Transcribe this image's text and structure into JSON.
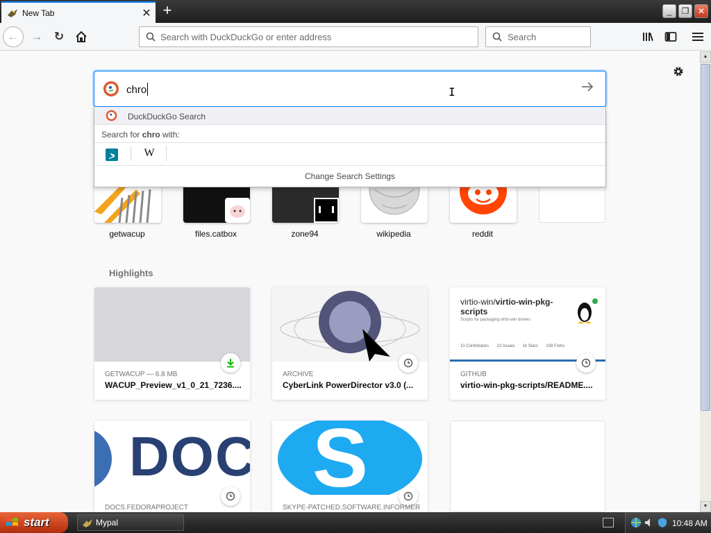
{
  "window": {
    "tab_title": "New Tab",
    "tab_close": "✕",
    "new_tab": "+",
    "minimize": "_",
    "restore": "❐",
    "close": "✕"
  },
  "navbar": {
    "back": "←",
    "forward": "→",
    "reload": "↻",
    "home": "⌂",
    "url_placeholder": "Search with DuckDuckGo or enter address",
    "search_placeholder": "Search"
  },
  "search": {
    "value": "chro",
    "engine_label": "DuckDuckGo Search",
    "search_for_prefix": "Search for ",
    "search_for_term": "chro",
    "search_for_suffix": " with:",
    "change_settings": "Change Search Settings",
    "engines": [
      "bing-icon",
      "wikipedia-icon"
    ]
  },
  "top_sites": [
    {
      "label": "getwacup"
    },
    {
      "label": "files.catbox"
    },
    {
      "label": "zone94"
    },
    {
      "label": "wikipedia"
    },
    {
      "label": "reddit"
    },
    {
      "label": ""
    }
  ],
  "highlights": {
    "title": "Highlights",
    "cards": [
      {
        "context": "GETWACUP — 6.8 MB",
        "title": "WACUP_Preview_v1_0_21_7236....",
        "badge": "download-icon"
      },
      {
        "context": "ARCHIVE",
        "title": "CyberLink PowerDirector v3.0 (...",
        "badge": "clock-icon"
      },
      {
        "context": "GITHUB",
        "title": "virtio-win-pkg-scripts/README....",
        "badge": "clock-icon",
        "preview_repo_owner": "virtio-win/",
        "preview_repo_name": "virtio-win-pkg-scripts",
        "preview_desc": "Scripts for packaging virtio-win drivers",
        "preview_stats": [
          {
            "value": "10",
            "label": "Contributors"
          },
          {
            "value": "22",
            "label": "Issues"
          },
          {
            "value": "1k",
            "label": "Stars"
          },
          {
            "value": "108",
            "label": "Forks"
          }
        ]
      },
      {
        "context": "DOCS.FEDORAPROJECT",
        "title": "",
        "badge": "clock-icon",
        "preview_text": "DOC"
      },
      {
        "context": "SKYPE-PATCHED.SOFTWARE.INFORMER",
        "title": "",
        "badge": "clock-icon",
        "preview_text": "S"
      },
      {
        "context": "",
        "title": "",
        "badge": ""
      }
    ]
  },
  "taskbar": {
    "start": "start",
    "task": "Mypal",
    "clock": "10:48 AM"
  },
  "colors": {
    "accent": "#0a84ff",
    "reddit": "#ff4500",
    "skype": "#1eaaf1",
    "fedora": "#294172",
    "github_bar": "#2b6cb0"
  }
}
